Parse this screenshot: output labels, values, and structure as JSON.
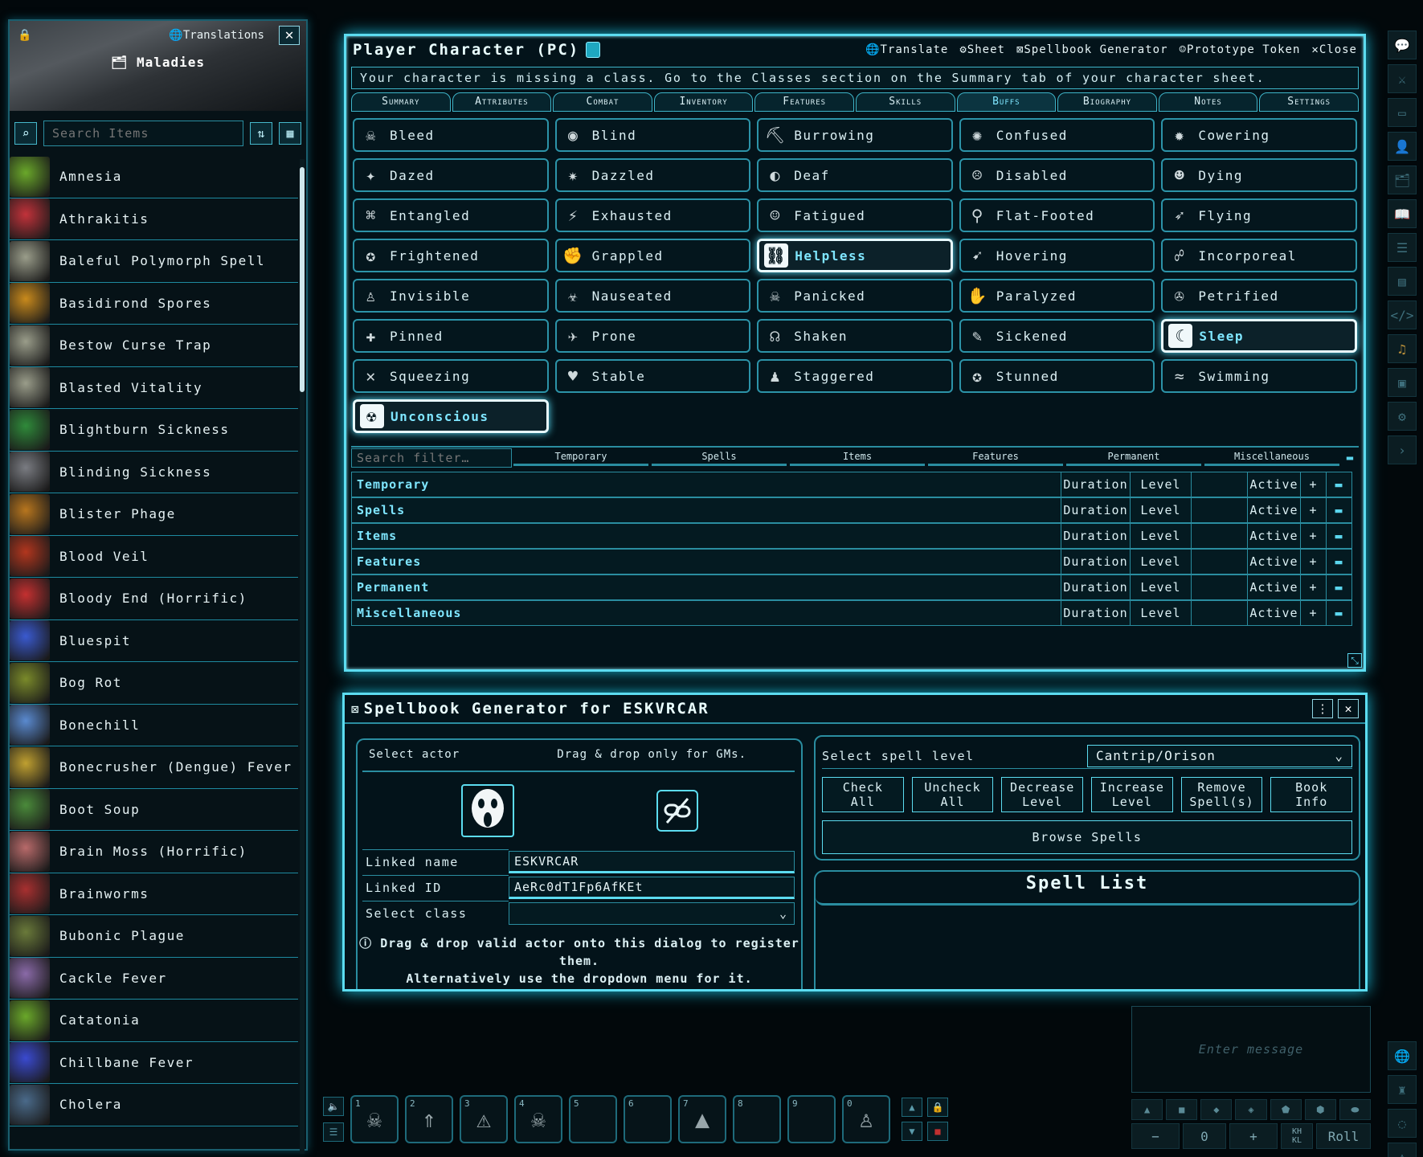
{
  "maladies_panel": {
    "translations_label": "Translations",
    "title": "Maladies",
    "search_placeholder": "Search Items",
    "items": [
      {
        "name": "Amnesia",
        "color": "#6aa82a"
      },
      {
        "name": "Athrakitis",
        "color": "#c2323a"
      },
      {
        "name": "Baleful Polymorph Spell",
        "color": "#9a9d8a"
      },
      {
        "name": "Basidirond Spores",
        "color": "#c98a1c"
      },
      {
        "name": "Bestow Curse Trap",
        "color": "#9a9d8a"
      },
      {
        "name": "Blasted Vitality",
        "color": "#9a9d8a"
      },
      {
        "name": "Blightburn Sickness",
        "color": "#2f8a3a"
      },
      {
        "name": "Blinding Sickness",
        "color": "#7a7c82"
      },
      {
        "name": "Blister Phage",
        "color": "#b8761e"
      },
      {
        "name": "Blood Veil",
        "color": "#b2361e"
      },
      {
        "name": "Bloody End (Horrific)",
        "color": "#c43030"
      },
      {
        "name": "Bluespit",
        "color": "#3a5ad0"
      },
      {
        "name": "Bog Rot",
        "color": "#7a8a2a"
      },
      {
        "name": "Bonechill",
        "color": "#5a8ad0"
      },
      {
        "name": "Bonecrusher (Dengue) Fever",
        "color": "#c0a030"
      },
      {
        "name": "Boot Soup",
        "color": "#4a8a3a"
      },
      {
        "name": "Brain Moss (Horrific)",
        "color": "#b86a6a"
      },
      {
        "name": "Brainworms",
        "color": "#a83030"
      },
      {
        "name": "Bubonic Plague",
        "color": "#6a7a3a"
      },
      {
        "name": "Cackle Fever",
        "color": "#8a6aa8"
      },
      {
        "name": "Catatonia",
        "color": "#6aa82a"
      },
      {
        "name": "Chillbane Fever",
        "color": "#3a4ad0"
      },
      {
        "name": "Cholera",
        "color": "#4a6a8a"
      }
    ]
  },
  "pc_window": {
    "title": "Player Character (PC)",
    "controls": [
      "Translate",
      "Sheet",
      "Spellbook Generator",
      "Prototype Token",
      "Close"
    ],
    "warning": "Your character is missing a class. Go to the Classes section on the Summary tab of your character sheet.",
    "tabs": [
      "Summary",
      "Attributes",
      "Combat",
      "Inventory",
      "Features",
      "Skills",
      "Buffs",
      "Biography",
      "Notes",
      "Settings"
    ],
    "active_tab": "Buffs",
    "conditions": [
      {
        "label": "Bleed",
        "icon": "bleed-icon",
        "glyph": "☠",
        "active": false
      },
      {
        "label": "Blind",
        "icon": "blind-icon",
        "glyph": "◉",
        "active": false
      },
      {
        "label": "Burrowing",
        "icon": "burrowing-icon",
        "glyph": "⛏",
        "active": false
      },
      {
        "label": "Confused",
        "icon": "confused-icon",
        "glyph": "✺",
        "active": false
      },
      {
        "label": "Cowering",
        "icon": "cowering-icon",
        "glyph": "✹",
        "active": false
      },
      {
        "label": "Dazed",
        "icon": "dazed-icon",
        "glyph": "✦",
        "active": false
      },
      {
        "label": "Dazzled",
        "icon": "dazzled-icon",
        "glyph": "✷",
        "active": false
      },
      {
        "label": "Deaf",
        "icon": "deaf-icon",
        "glyph": "◐",
        "active": false
      },
      {
        "label": "Disabled",
        "icon": "disabled-icon",
        "glyph": "☹",
        "active": false
      },
      {
        "label": "Dying",
        "icon": "dying-icon",
        "glyph": "☻",
        "active": false
      },
      {
        "label": "Entangled",
        "icon": "entangled-icon",
        "glyph": "⌘",
        "active": false
      },
      {
        "label": "Exhausted",
        "icon": "exhausted-icon",
        "glyph": "⚡",
        "active": false
      },
      {
        "label": "Fatigued",
        "icon": "fatigued-icon",
        "glyph": "☺",
        "active": false
      },
      {
        "label": "Flat-Footed",
        "icon": "flat-footed-icon",
        "glyph": "⚲",
        "active": false
      },
      {
        "label": "Flying",
        "icon": "flying-icon",
        "glyph": "➶",
        "active": false
      },
      {
        "label": "Frightened",
        "icon": "frightened-icon",
        "glyph": "✪",
        "active": false
      },
      {
        "label": "Grappled",
        "icon": "grappled-icon",
        "glyph": "✊",
        "active": false
      },
      {
        "label": "Helpless",
        "icon": "helpless-icon",
        "glyph": "⛓",
        "active": true
      },
      {
        "label": "Hovering",
        "icon": "hovering-icon",
        "glyph": "➹",
        "active": false
      },
      {
        "label": "Incorporeal",
        "icon": "incorporeal-icon",
        "glyph": "☍",
        "active": false
      },
      {
        "label": "Invisible",
        "icon": "invisible-icon",
        "glyph": "♙",
        "active": false
      },
      {
        "label": "Nauseated",
        "icon": "nauseated-icon",
        "glyph": "☣",
        "active": false
      },
      {
        "label": "Panicked",
        "icon": "panicked-icon",
        "glyph": "☠",
        "active": false
      },
      {
        "label": "Paralyzed",
        "icon": "paralyzed-icon",
        "glyph": "✋",
        "active": false
      },
      {
        "label": "Petrified",
        "icon": "petrified-icon",
        "glyph": "✇",
        "active": false
      },
      {
        "label": "Pinned",
        "icon": "pinned-icon",
        "glyph": "✚",
        "active": false
      },
      {
        "label": "Prone",
        "icon": "prone-icon",
        "glyph": "✈",
        "active": false
      },
      {
        "label": "Shaken",
        "icon": "shaken-icon",
        "glyph": "☊",
        "active": false
      },
      {
        "label": "Sickened",
        "icon": "sickened-icon",
        "glyph": "✎",
        "active": false
      },
      {
        "label": "Sleep",
        "icon": "sleep-icon",
        "glyph": "☾",
        "active": true
      },
      {
        "label": "Squeezing",
        "icon": "squeezing-icon",
        "glyph": "✕",
        "active": false
      },
      {
        "label": "Stable",
        "icon": "stable-icon",
        "glyph": "♥",
        "active": false
      },
      {
        "label": "Staggered",
        "icon": "staggered-icon",
        "glyph": "♟",
        "active": false
      },
      {
        "label": "Stunned",
        "icon": "stunned-icon",
        "glyph": "✪",
        "active": false
      },
      {
        "label": "Swimming",
        "icon": "swimming-icon",
        "glyph": "≈",
        "active": false
      },
      {
        "label": "Unconscious",
        "icon": "unconscious-icon",
        "glyph": "☢",
        "active": true
      }
    ],
    "buff_filter_placeholder": "Search filter…",
    "filter_tabs": [
      "Temporary",
      "Spells",
      "Items",
      "Features",
      "Permanent",
      "Miscellaneous"
    ],
    "buff_rows": [
      "Temporary",
      "Spells",
      "Items",
      "Features",
      "Permanent",
      "Miscellaneous"
    ],
    "col_duration": "Duration",
    "col_level": "Level",
    "col_active": "Active",
    "add_symbol": "+"
  },
  "spellbook": {
    "title": "Spellbook Generator for ESKVRCAR",
    "select_actor": "Select actor",
    "drag_note": "Drag & drop only for GMs.",
    "linked_name_label": "Linked name",
    "linked_name": "ESKVRCAR",
    "linked_id_label": "Linked ID",
    "linked_id": "AeRc0dT1Fp6AfKEt",
    "select_class_label": "Select class",
    "info_line1": "Drag & drop valid actor onto this dialog to register them.",
    "info_line2": "Alternatively use the dropdown menu for it.",
    "select_spell_level_label": "Select spell level",
    "spell_level_value": "Cantrip/Orison",
    "buttons": [
      {
        "line1": "Check",
        "line2": "All"
      },
      {
        "line1": "Uncheck",
        "line2": "All"
      },
      {
        "line1": "Decrease",
        "line2": "Level"
      },
      {
        "line1": "Increase",
        "line2": "Level"
      },
      {
        "line1": "Remove",
        "line2": "Spell(s)"
      },
      {
        "line1": "Book",
        "line2": "Info"
      }
    ],
    "browse_spells": "Browse Spells",
    "spell_list_title": "Spell List"
  },
  "hotbar": {
    "slots": [
      {
        "num": "1",
        "glyph": "☠"
      },
      {
        "num": "2",
        "glyph": "⇑"
      },
      {
        "num": "3",
        "glyph": "⚠"
      },
      {
        "num": "4",
        "glyph": "☠"
      },
      {
        "num": "5",
        "glyph": ""
      },
      {
        "num": "6",
        "glyph": ""
      },
      {
        "num": "7",
        "glyph": "▲"
      },
      {
        "num": "8",
        "glyph": ""
      },
      {
        "num": "9",
        "glyph": ""
      },
      {
        "num": "0",
        "glyph": "♙"
      }
    ]
  },
  "chat": {
    "placeholder": "Enter message",
    "roll_modifier": "0",
    "kh_label": "KH",
    "kl_label": "KL",
    "roll_label": "Roll"
  }
}
